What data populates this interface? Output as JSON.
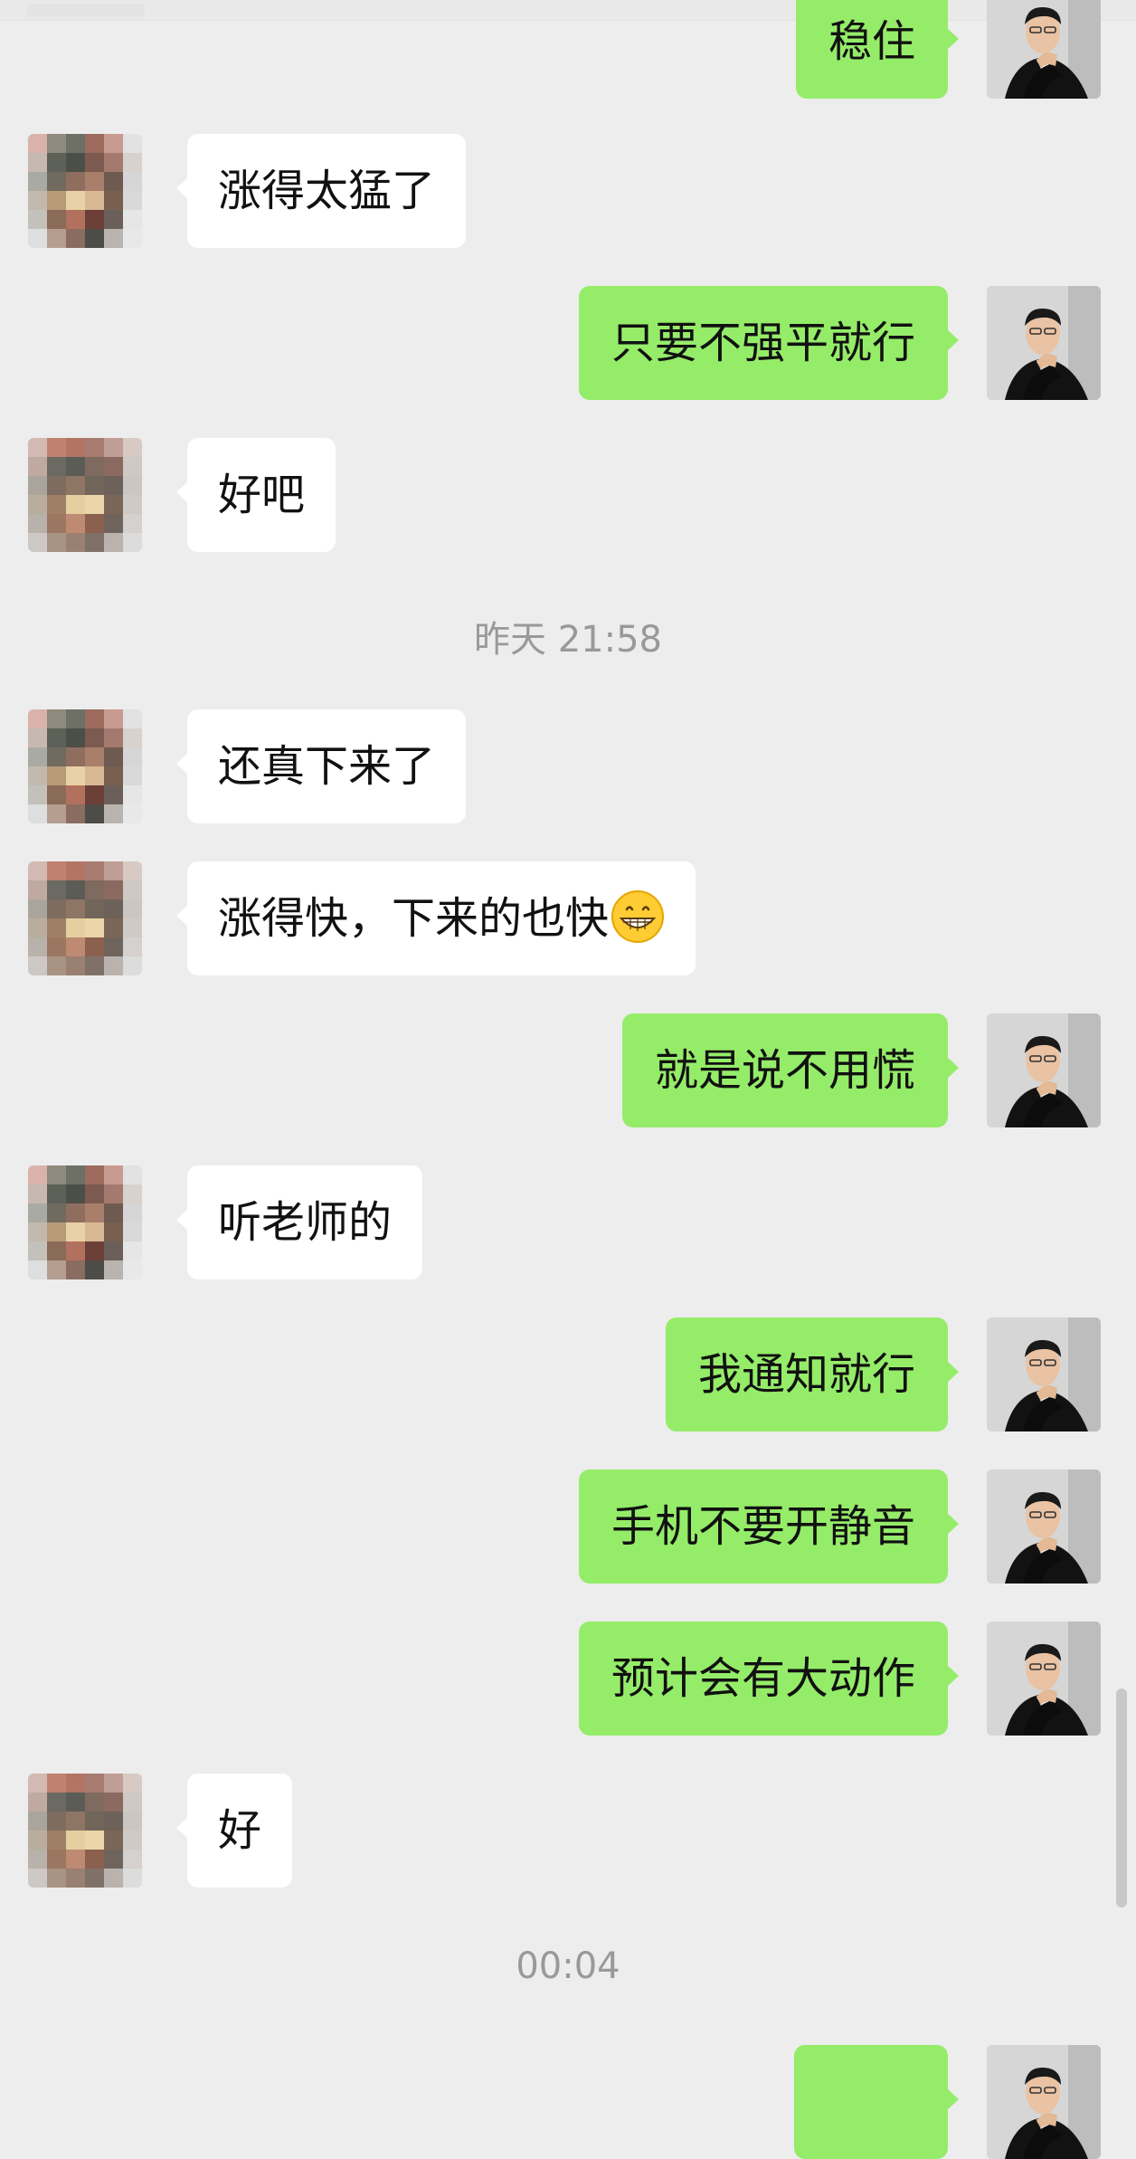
{
  "messages": {
    "m0": "稳住",
    "m1": "涨得太猛了",
    "m2": "只要不强平就行",
    "m3": "好吧",
    "m4": "还真下来了",
    "m5": "涨得快，下来的也快",
    "m5_emoji": "grinning-face-emoji",
    "m6": "就是说不用慌",
    "m7": "听老师的",
    "m8": "我通知就行",
    "m9": "手机不要开静音",
    "m10": "预计会有大动作",
    "m11": "好"
  },
  "timestamps": {
    "t1": "昨天 21:58",
    "t2": "00:04"
  },
  "colors": {
    "background": "#ededed",
    "self_bubble": "#95ec69",
    "other_bubble": "#ffffff",
    "timestamp_text": "#999999"
  }
}
